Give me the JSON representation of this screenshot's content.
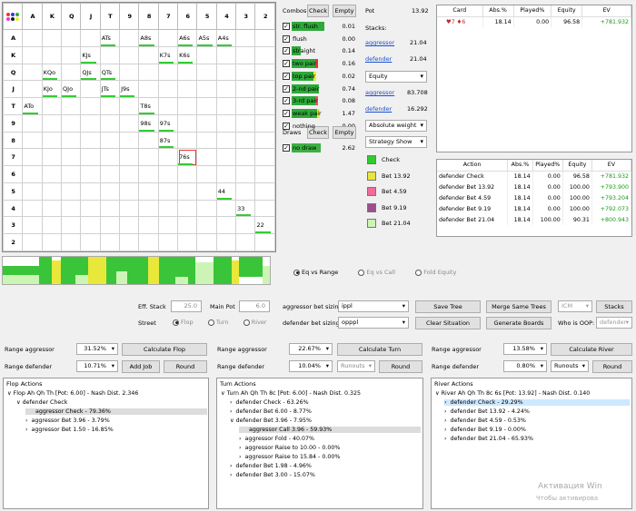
{
  "grid": {
    "headers": [
      "A",
      "K",
      "Q",
      "J",
      "T",
      "9",
      "8",
      "7",
      "6",
      "5",
      "4",
      "3",
      "2"
    ],
    "cells": [
      {
        "row": 0,
        "col": 4,
        "text": "ATs"
      },
      {
        "row": 0,
        "col": 6,
        "text": "A8s"
      },
      {
        "row": 0,
        "col": 8,
        "text": "A6s"
      },
      {
        "row": 0,
        "col": 9,
        "text": "A5s"
      },
      {
        "row": 0,
        "col": 10,
        "text": "A4s"
      },
      {
        "row": 1,
        "col": 3,
        "text": "KJs"
      },
      {
        "row": 1,
        "col": 7,
        "text": "K7s"
      },
      {
        "row": 1,
        "col": 8,
        "text": "K6s"
      },
      {
        "row": 2,
        "col": 1,
        "text": "KQo"
      },
      {
        "row": 2,
        "col": 3,
        "text": "QJs"
      },
      {
        "row": 2,
        "col": 4,
        "text": "QTs"
      },
      {
        "row": 3,
        "col": 1,
        "text": "KJo"
      },
      {
        "row": 3,
        "col": 2,
        "text": "QJo"
      },
      {
        "row": 3,
        "col": 4,
        "text": "JTs"
      },
      {
        "row": 3,
        "col": 5,
        "text": "J9s"
      },
      {
        "row": 4,
        "col": 0,
        "text": "ATo"
      },
      {
        "row": 4,
        "col": 6,
        "text": "T8s"
      },
      {
        "row": 5,
        "col": 6,
        "text": "98s"
      },
      {
        "row": 5,
        "col": 7,
        "text": "97s"
      },
      {
        "row": 6,
        "col": 7,
        "text": "87s"
      },
      {
        "row": 7,
        "col": 8,
        "text": "76s",
        "selected": true
      },
      {
        "row": 9,
        "col": 10,
        "text": "44"
      },
      {
        "row": 10,
        "col": 11,
        "text": "33"
      },
      {
        "row": 11,
        "col": 12,
        "text": "22"
      }
    ]
  },
  "combos": {
    "title": "Combos",
    "check": "Check",
    "empty": "Empty",
    "rows": [
      {
        "label": "str. flush",
        "value": "0.01",
        "fill": 0.9,
        "color": "#2fa83a"
      },
      {
        "label": "flush",
        "value": "0.00",
        "fill": 0,
        "color": "#2fa83a"
      },
      {
        "label": "straight",
        "value": "0.14",
        "fill": 0.25,
        "color": "#2fa83a"
      },
      {
        "label": "two pair",
        "value": "0.16",
        "fill": 0.65,
        "color": "#2fa83a",
        "accent": "#e33"
      },
      {
        "label": "top pair",
        "value": "0.02",
        "fill": 0.6,
        "color": "#2fa83a",
        "accent": "#ee2"
      },
      {
        "label": "2-nd pair",
        "value": "0.74",
        "fill": 0.75,
        "color": "#2fa83a"
      },
      {
        "label": "3-rd pair",
        "value": "0.08",
        "fill": 0.65,
        "color": "#2fa83a",
        "accent": "#e55"
      },
      {
        "label": "weak pair",
        "value": "1.47",
        "fill": 0.7,
        "color": "#2fa83a",
        "accent": "#ee2"
      },
      {
        "label": "nothing",
        "value": "0.00",
        "fill": 0,
        "color": "#2fa83a"
      }
    ],
    "draws_title": "Draws",
    "draws_check": "Check",
    "draws_empty": "Empty",
    "draw_row": {
      "label": "no draw",
      "value": "2.62"
    }
  },
  "pot": {
    "label": "Pot",
    "value": "13.92",
    "stacks_label": "Stacks:",
    "aggressor": "aggressor",
    "aggressor_stack": "21.04",
    "defender": "defender",
    "defender_stack": "21.04",
    "metric": "Equity",
    "agg_equity": "83.708",
    "def_equity": "16.292",
    "weight": "Absolute weight",
    "strategy": "Strategy Show"
  },
  "legend": [
    {
      "label": "Check",
      "color": "#2ecc2e"
    },
    {
      "label": "Bet 13.92",
      "color": "#e8e83a"
    },
    {
      "label": "Bet 4.59",
      "color": "#f06c9b"
    },
    {
      "label": "Bet 9.19",
      "color": "#9b4f8e"
    },
    {
      "label": "Bet 21.04",
      "color": "#ccf5b5"
    }
  ],
  "card_table": {
    "headers": [
      "Card",
      "Abs.%",
      "Played%",
      "Equity",
      "EV"
    ],
    "rows": [
      [
        "♥7 ♦6",
        "18.14",
        "0.00",
        "96.58",
        "+781.932"
      ]
    ]
  },
  "action_table": {
    "headers": [
      "Action",
      "Abs.%",
      "Played%",
      "Equity",
      "EV"
    ],
    "rows": [
      [
        "defender Check",
        "18.14",
        "0.00",
        "96.58",
        "+781.932"
      ],
      [
        "defender Bet 13.92",
        "18.14",
        "0.00",
        "100.00",
        "+793.900"
      ],
      [
        "defender Bet 4.59",
        "18.14",
        "0.00",
        "100.00",
        "+793.204"
      ],
      [
        "defender Bet 9.19",
        "18.14",
        "0.00",
        "100.00",
        "+792.073"
      ],
      [
        "defender Bet 21.04",
        "18.14",
        "100.00",
        "90.31",
        "+800.943"
      ]
    ]
  },
  "eq_radios": [
    "Eq vs Range",
    "Eq vs Call",
    "Fold Equity"
  ],
  "board": [
    {
      "rank": "A",
      "suit": "♥",
      "color": "#c0282c"
    },
    {
      "rank": "Q",
      "suit": "♥",
      "color": "#c0282c"
    },
    {
      "rank": "T",
      "suit": "♥",
      "color": "#c0282c"
    },
    {
      "rank": "8",
      "suit": "♣",
      "color": "#1b7a2a"
    },
    {
      "rank": "6",
      "suit": "♠",
      "color": "#3a3a3a"
    }
  ],
  "controls": {
    "eff_stack_label": "Eff. Stack",
    "eff_stack": "25.0",
    "main_pot_label": "Main Pot",
    "main_pot": "6.0",
    "street_label": "Street",
    "streets": [
      "Flop",
      "Turn",
      "River"
    ],
    "agg_sizing_label": "aggressor bet sizing:",
    "agg_sizing": "ippl",
    "def_sizing_label": "defender bet sizing:",
    "def_sizing": "opppl",
    "save_tree": "Save Tree",
    "merge": "Merge Same Trees",
    "icm": "ICM",
    "stacks": "Stacks",
    "clear": "Clear Situation",
    "generate": "Generate Boards",
    "who_oop": "Who is OOP:",
    "oop_val": "defender"
  },
  "ranges": {
    "flop": {
      "agg_label": "Range aggressor",
      "agg": "31.52%",
      "def_label": "Range defender",
      "def": "10.71%",
      "calc": "Calculate Flop",
      "add_job": "Add Job",
      "round": "Round"
    },
    "turn": {
      "agg_label": "Range aggressor",
      "agg": "22.67%",
      "def_label": "Range defender",
      "def": "10.04%",
      "calc": "Calculate Turn",
      "runouts": "Runouts",
      "round": "Round"
    },
    "river": {
      "agg_label": "Range aggressor",
      "agg": "13.58%",
      "def_label": "Range defender",
      "def": "0.80%",
      "calc": "Calculate River",
      "runouts": "Runouts",
      "round": "Round"
    }
  },
  "flop_tree": {
    "title": "Flop Actions",
    "nodes": [
      "Flop Ah Qh Th [Pot: 6.00] - Nash Dist. 2.346",
      "defender Check",
      "aggressor Check - 79.36%",
      "aggressor Bet 3.96 - 3.79%",
      "aggressor Bet 1.50 - 16.85%"
    ]
  },
  "turn_tree": {
    "title": "Turn Actions",
    "nodes": [
      "Turn Ah Qh Th 8c [Pot: 6.00] - Nash Dist. 0.325",
      "defender Check - 63.26%",
      "defender Bet 6.00 - 8.77%",
      "defender Bet 3.96 - 7.95%",
      "aggressor Call 3.96 - 59.93%",
      "aggressor Fold - 40.07%",
      "aggressor Raise to 10.00 - 0.00%",
      "aggressor Raise to 15.84 - 0.00%",
      "defender Bet 1.98 - 4.96%",
      "defender Bet 3.00 - 15.07%"
    ]
  },
  "river_tree": {
    "title": "River Actions",
    "nodes": [
      "River Ah Qh Th 8c 6s [Pot: 13.92] - Nash Dist. 0.140",
      "defender Check - 29.29%",
      "defender Bet 13.92 - 4.24%",
      "defender Bet 4.59 - 0.53%",
      "defender Bet 9.19 - 0.00%",
      "defender Bet 21.04 - 65.93%"
    ]
  },
  "watermark": {
    "line1": "Активация Win",
    "line2": "Чтобы активирова"
  }
}
